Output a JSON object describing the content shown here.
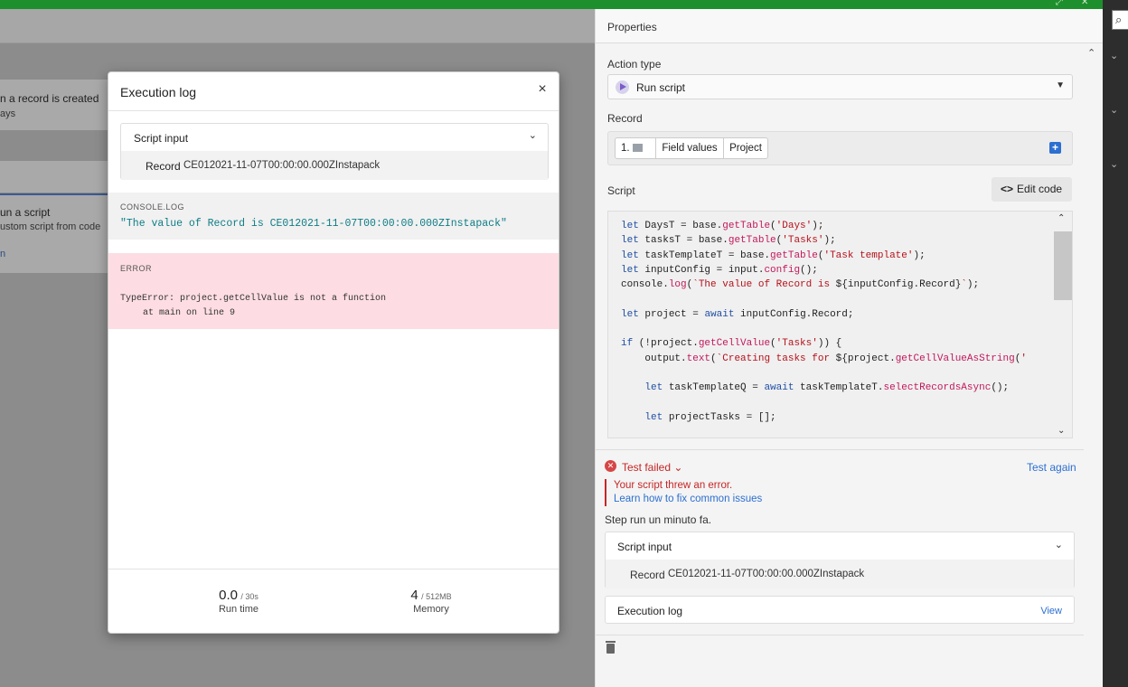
{
  "canvas": {
    "trigger": {
      "line1": "n a record is created",
      "line2": "ays"
    },
    "action": {
      "line1": "un a script",
      "line2": "ustom script from code",
      "line3": "n"
    }
  },
  "modal": {
    "title": "Execution log",
    "close": "×",
    "script_input": {
      "label": "Script input",
      "key": "Record",
      "value": "CE012021-11-07T00:00:00.000ZInstapack"
    },
    "console": {
      "title": "CONSOLE.LOG",
      "text": "\"The value of Record is CE012021-11-07T00:00:00.000ZInstapack\""
    },
    "error": {
      "title": "ERROR",
      "line1": "TypeError: project.getCellValue is not a function",
      "line2": "at main on line 9"
    },
    "stats": {
      "runtime": {
        "value": "0.0",
        "limit": "/ 30s",
        "label": "Run time"
      },
      "memory": {
        "value": "4",
        "limit": "/ 512MB",
        "label": "Memory"
      }
    }
  },
  "panel": {
    "title": "Properties",
    "action_type": {
      "label": "Action type",
      "value": "Run script"
    },
    "record": {
      "label": "Record",
      "pills": [
        "1.",
        "Field values",
        "Project"
      ]
    },
    "script": {
      "label": "Script",
      "edit_button": "Edit code"
    },
    "test": {
      "status": "Test failed",
      "again": "Test again",
      "error_msg": "Your script threw an error.",
      "learn_link": "Learn how to fix common issues",
      "step_run": "Step run un minuto fa."
    },
    "script_input": {
      "label": "Script input",
      "key": "Record",
      "value": "CE012021-11-07T00:00:00.000ZInstapack"
    },
    "exec_log": {
      "label": "Execution log",
      "view": "View"
    }
  },
  "colors": {
    "accent_green": "#1d8f2c",
    "error_red": "#c62626",
    "link_blue": "#2d6fd1",
    "console_teal": "#0e7c86"
  }
}
